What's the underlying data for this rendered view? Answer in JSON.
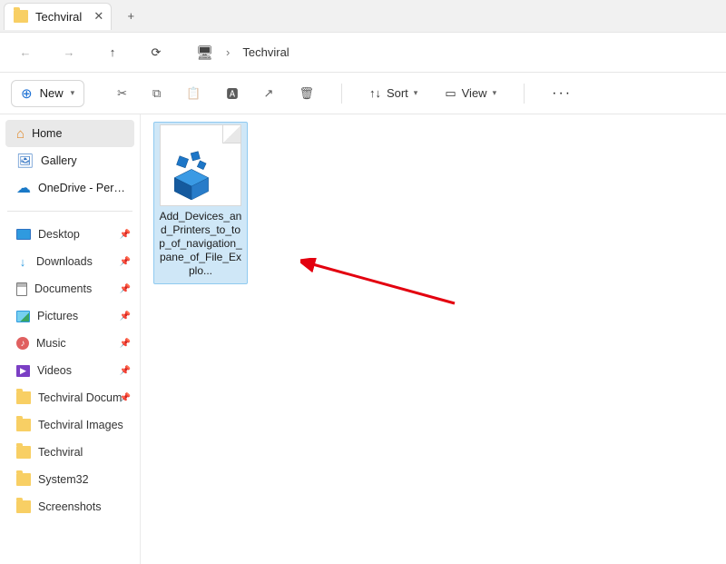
{
  "tab": {
    "title": "Techviral",
    "close_glyph": "✕",
    "newtab_glyph": "+"
  },
  "nav": {
    "back_glyph": "←",
    "forward_glyph": "→",
    "up_glyph": "↑",
    "refresh_glyph": "⟳",
    "monitor_glyph": "🖥",
    "sep_glyph": "›",
    "crumb": "Techviral"
  },
  "toolbar": {
    "new_glyph": "⊕",
    "new_label": "New",
    "cut_glyph": "✂",
    "copy_glyph": "⧉",
    "paste_glyph": "📋",
    "rename_glyph": "🅰",
    "share_glyph": "↗",
    "delete_glyph": "🗑",
    "sort_glyph": "↑↓",
    "sort_label": "Sort",
    "view_glyph": "▭",
    "view_label": "View",
    "more_glyph": "···"
  },
  "sidebar": {
    "top": [
      {
        "name": "home",
        "label": "Home",
        "icon_class": "home-icon",
        "glyph": "⌂",
        "selected": true
      },
      {
        "name": "gallery",
        "label": "Gallery",
        "icon_class": "gallery-icon",
        "glyph": "🖼"
      },
      {
        "name": "onedrive",
        "label": "OneDrive - Persona",
        "icon_class": "cloud-icon",
        "glyph": "☁",
        "expandable": true
      }
    ],
    "quick": [
      {
        "name": "desktop",
        "label": "Desktop",
        "type": "dt",
        "pin": "📌"
      },
      {
        "name": "downloads",
        "label": "Downloads",
        "type": "dl",
        "pin": "📌"
      },
      {
        "name": "documents",
        "label": "Documents",
        "type": "doc",
        "pin": "📌"
      },
      {
        "name": "pictures",
        "label": "Pictures",
        "type": "pic",
        "pin": "📌"
      },
      {
        "name": "music",
        "label": "Music",
        "type": "music",
        "pin": "📌"
      },
      {
        "name": "videos",
        "label": "Videos",
        "type": "video",
        "pin": "📌"
      },
      {
        "name": "techviral-docum",
        "label": "Techviral Docum",
        "type": "folder",
        "pin": "📌"
      },
      {
        "name": "techviral-images",
        "label": "Techviral Images",
        "type": "folder"
      },
      {
        "name": "techviral",
        "label": "Techviral",
        "type": "folder"
      },
      {
        "name": "system32",
        "label": "System32",
        "type": "folder"
      },
      {
        "name": "screenshots",
        "label": "Screenshots",
        "type": "folder"
      }
    ]
  },
  "files": [
    {
      "name": "reg-file",
      "label": "Add_Devices_and_Printers_to_top_of_navigation_pane_of_File_Explo...",
      "selected": true
    }
  ]
}
